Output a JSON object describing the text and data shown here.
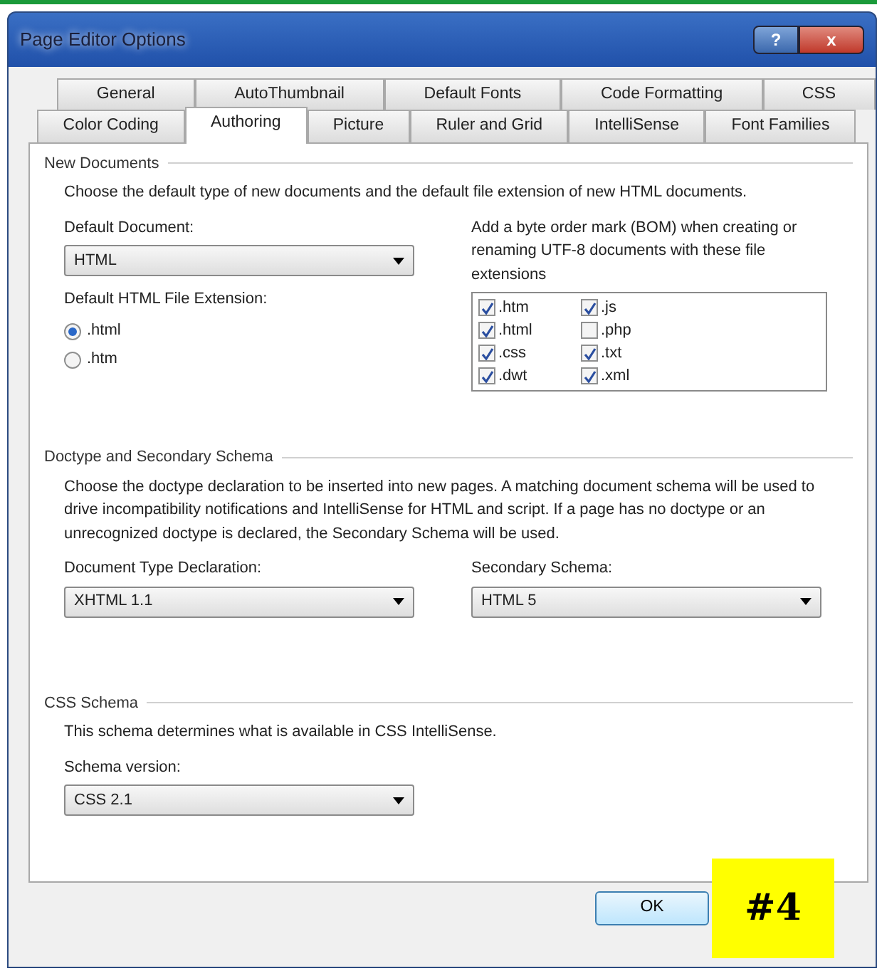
{
  "window": {
    "title": "Page Editor Options",
    "controls": [
      "?",
      "x"
    ]
  },
  "tab_rows": [
    [
      {
        "label": "General",
        "selected": false
      },
      {
        "label": "AutoThumbnail",
        "selected": false
      },
      {
        "label": "Default Fonts",
        "selected": false
      },
      {
        "label": "Code Formatting",
        "selected": false
      },
      {
        "label": "CSS",
        "selected": false
      }
    ],
    [
      {
        "label": "Color Coding",
        "selected": false
      },
      {
        "label": "Authoring",
        "selected": true
      },
      {
        "label": "Picture",
        "selected": false
      },
      {
        "label": "Ruler and Grid",
        "selected": false
      },
      {
        "label": "IntelliSense",
        "selected": false
      },
      {
        "label": "Font Families",
        "selected": false
      }
    ]
  ],
  "new_documents": {
    "heading": "New Documents",
    "description": "Choose the default type of new documents and the default file extension of new HTML documents.",
    "default_document": {
      "label": "Default Document:",
      "value": "HTML"
    },
    "extension": {
      "label": "Default HTML File Extension:",
      "options": [
        {
          "label": ".html",
          "selected": true
        },
        {
          "label": ".htm",
          "selected": false
        }
      ]
    },
    "bom": {
      "label": "Add a byte order mark (BOM) when creating or renaming UTF-8 documents with these file extensions",
      "extensions": [
        {
          "label": ".htm",
          "checked": true
        },
        {
          "label": ".html",
          "checked": true
        },
        {
          "label": ".css",
          "checked": true
        },
        {
          "label": ".dwt",
          "checked": true
        },
        {
          "label": ".js",
          "checked": true
        },
        {
          "label": ".php",
          "checked": false
        },
        {
          "label": ".txt",
          "checked": true
        },
        {
          "label": ".xml",
          "checked": true
        }
      ]
    }
  },
  "doctype": {
    "heading": "Doctype and Secondary Schema",
    "description": "Choose the doctype declaration to be inserted into new pages. A matching document schema will be used to drive incompatibility notifications and IntelliSense for HTML and script. If a page has no doctype or an unrecognized doctype is declared, the Secondary Schema will be used.",
    "fields": [
      {
        "label": "Document Type Declaration:",
        "value": "XHTML 1.1"
      },
      {
        "label": "Secondary Schema:",
        "value": "HTML 5"
      }
    ]
  },
  "css_schema": {
    "heading": "CSS Schema",
    "description": "This schema determines what is available in CSS IntelliSense.",
    "field": {
      "label": "Schema version:",
      "value": "CSS 2.1"
    }
  },
  "buttons": [
    "OK"
  ],
  "step_label": "#4"
}
